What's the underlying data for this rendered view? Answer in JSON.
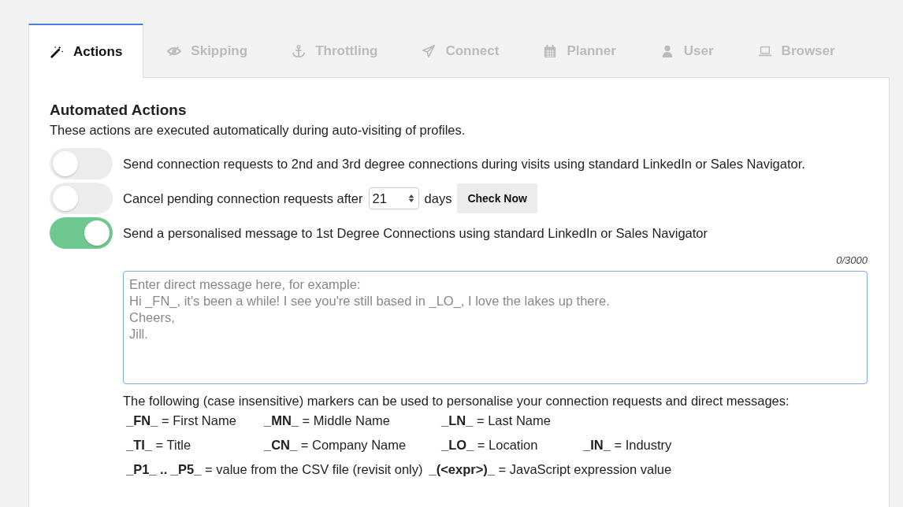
{
  "tabs": [
    {
      "label": "Actions",
      "kind": "wand",
      "selected": true
    },
    {
      "label": "Skipping",
      "kind": "eye-slash",
      "selected": false
    },
    {
      "label": "Throttling",
      "kind": "anchor",
      "selected": false
    },
    {
      "label": "Connect",
      "kind": "plane",
      "selected": false
    },
    {
      "label": "Planner",
      "kind": "calendar",
      "selected": false
    },
    {
      "label": "User",
      "kind": "user",
      "selected": false
    },
    {
      "label": "Browser",
      "kind": "laptop",
      "selected": false
    }
  ],
  "section": {
    "title": "Automated Actions",
    "description": "These actions are executed automatically during auto-visiting of profiles."
  },
  "settings": [
    {
      "kind": "text",
      "on": false,
      "label": "Send connection requests to 2nd and 3rd degree connections during visits using standard LinkedIn or Sales Navigator."
    },
    {
      "kind": "days",
      "on": false,
      "label": "Cancel pending connection requests after",
      "value": "21",
      "unit": "days",
      "button": "Check Now"
    },
    {
      "kind": "text",
      "on": true,
      "label": "Send a personalised message to 1st Degree Connections using standard LinkedIn or Sales Navigator"
    }
  ],
  "message": {
    "counter": "0/3000",
    "placeholder": "Enter direct message here, for example:\nHi _FN_, it's been a while! I see you're still based in _LO_, I love the lakes up there.\nCheers,\nJill."
  },
  "markers_intro": "The following (case insensitive) markers can be used to personalise your connection requests and direct messages:",
  "markers": [
    [
      "**_FN_** = First Name",
      "**_MN_** = Middle Name",
      "**_LN_** = Last Name"
    ],
    [
      "**_TI_** = Title",
      "**_CN_** = Company Name",
      "**_LO_** = Location",
      "**_IN_** = Industry"
    ],
    [
      "**_P1_ .. _P5_** = value from the CSV file (revisit only)",
      "**_(<expr>)_** = JavaScript expression value"
    ]
  ]
}
